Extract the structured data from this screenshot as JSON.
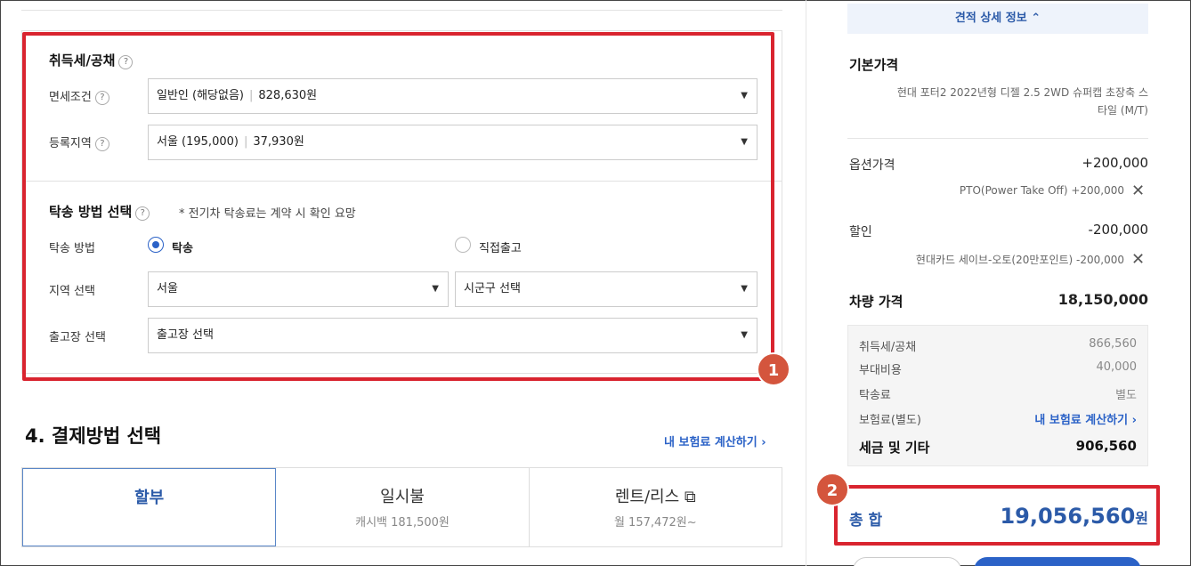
{
  "tax": {
    "title": "취득세/공채",
    "help": "?",
    "exempt_label": "면세조건",
    "exempt_value": "일반인 (해당없음)",
    "exempt_amount": "828,630원",
    "region_label": "등록지역",
    "region_value": "서울 (195,000)",
    "region_amount": "37,930원"
  },
  "delivery": {
    "title": "탁송 방법 선택",
    "note": "* 전기차 탁송료는 계약 시 확인 요망",
    "method_label": "탁송 방법",
    "option_delivery": "탁송",
    "option_pickup": "직접출고",
    "area_label": "지역 선택",
    "area_value": "서울",
    "district_placeholder": "시군구 선택",
    "depot_label": "출고장 선택",
    "depot_placeholder": "출고장 선택"
  },
  "badges": {
    "one": "1",
    "two": "2"
  },
  "payment": {
    "title": "4. 결제방법 선택",
    "insurance_link": "내 보험료 계산하기 ›",
    "tabs": [
      {
        "title": "할부",
        "sub": ""
      },
      {
        "title": "일시불",
        "sub": "캐시백 181,500원"
      },
      {
        "title": "렌트/리스 ⧉",
        "sub": "월 157,472원~"
      }
    ]
  },
  "summary": {
    "detail_toggle": "견적 상세 정보 ⌃",
    "base_title": "기본가격",
    "base_desc_1": "현대 포터2 2022년형 디젤 2.5 2WD 슈퍼캡 초장축 스",
    "base_desc_2": "타일 (M/T)",
    "option_label": "옵션가격",
    "option_value": "+200,000",
    "option_item": "PTO(Power Take Off)  +200,000",
    "discount_label": "할인",
    "discount_value": "-200,000",
    "discount_item": "현대카드 세이브-오토(20만포인트)  -200,000",
    "vehicle_label": "차량 가격",
    "vehicle_value": "18,150,000",
    "tax_rows": [
      {
        "label": "취득세/공채",
        "value": "866,560"
      },
      {
        "label": "부대비용",
        "value": "40,000"
      },
      {
        "label": "탁송료",
        "value": "별도"
      },
      {
        "label": "보험료(별도)",
        "value": "내 보험료 계산하기 ›"
      }
    ],
    "tax_sum_label": "세금 및 기타",
    "tax_sum_value": "906,560",
    "total_label": "총 합",
    "total_value": "19,056,560",
    "total_unit": "원"
  }
}
